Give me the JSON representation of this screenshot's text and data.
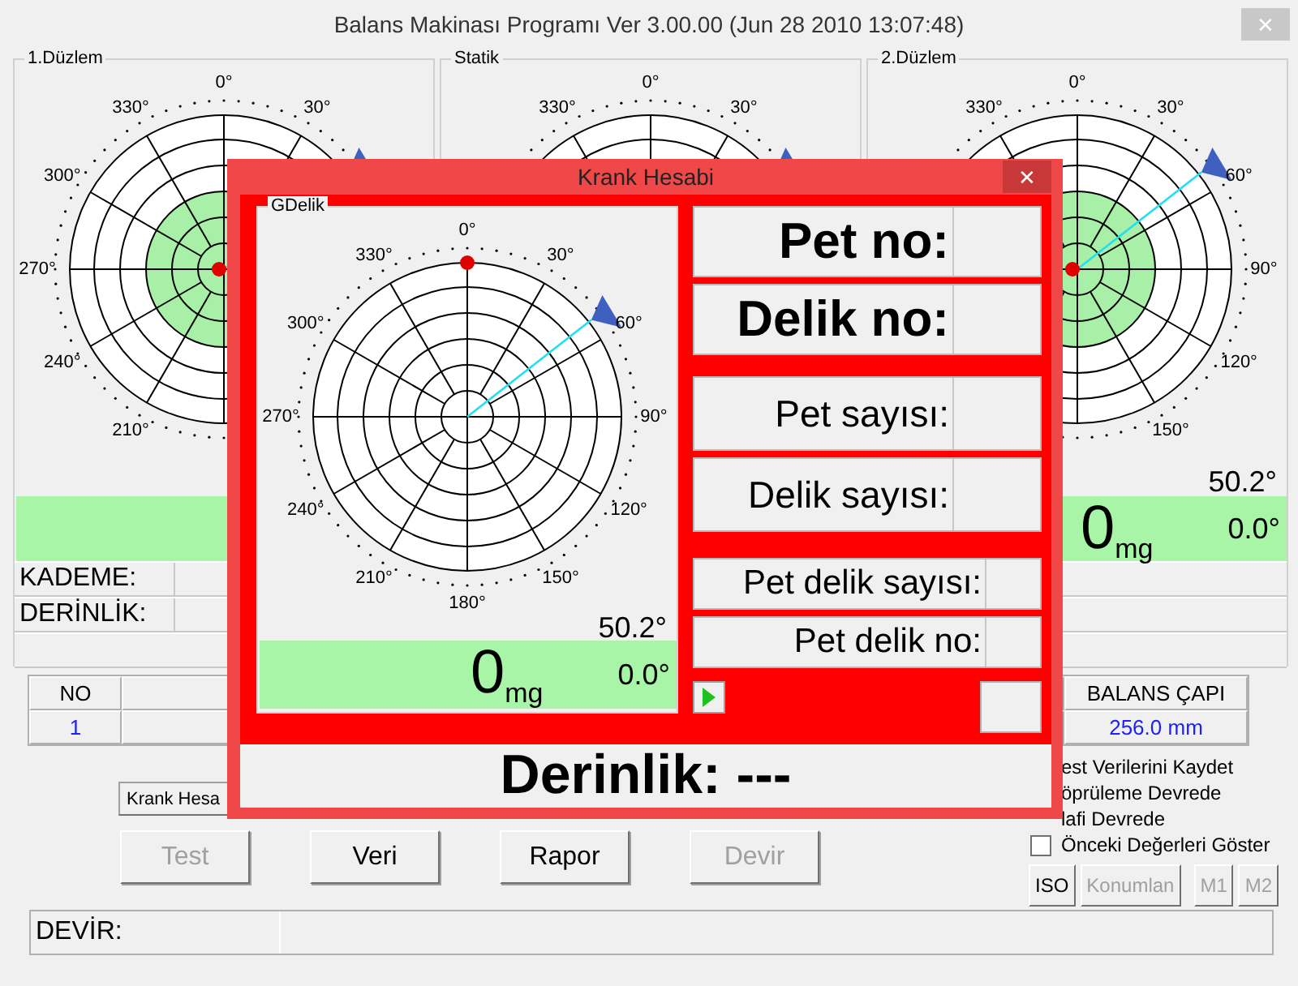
{
  "window": {
    "title": "Balans Makinası Programı Ver 3.00.00 (Jun 28 2010 13:07:48)",
    "close": "✕"
  },
  "planes": [
    {
      "title": "1.Düzlem",
      "polar": {
        "green_zone": true,
        "center_dot": true,
        "pointer": true,
        "labels": {
          "at_0": "0°",
          "at_30": "30°",
          "at_330": "330°",
          "at_300": "300°",
          "at_270": "270°",
          "at_240": "240°",
          "at_210": "210°"
        }
      },
      "reading_bar": true,
      "rows": [
        {
          "kind": "field",
          "label": "KADEME:"
        },
        {
          "kind": "field",
          "label": "DERİNLİK:"
        },
        {
          "kind": "blank"
        }
      ]
    },
    {
      "title": "Statik",
      "polar": {
        "pointer": true,
        "labels": {
          "at_0": "0°",
          "at_30": "30°",
          "at_330": "330°"
        }
      }
    },
    {
      "title": "2.Düzlem",
      "polar": {
        "green_zone": true,
        "center_dot": true,
        "pointer": true,
        "labels": {
          "at_0": "0°",
          "at_30": "30°",
          "at_60": "60°",
          "at_90": "90°",
          "at_120": "120°",
          "at_150": "150°",
          "at_330": "330°"
        }
      },
      "reading_bar": true,
      "angle": "50.2°",
      "amount": "0",
      "unit": "mg",
      "phase": "0.0°",
      "rows": [
        {
          "kind": "blank"
        },
        {
          "kind": "blank"
        },
        {
          "kind": "blank"
        }
      ]
    }
  ],
  "no_table": {
    "header": "NO",
    "value": "1"
  },
  "krank_button": {
    "label": "Krank Hesa"
  },
  "buttons": [
    {
      "label": "Test",
      "disabled": true
    },
    {
      "label": "Veri",
      "disabled": false
    },
    {
      "label": "Rapor",
      "disabled": false
    },
    {
      "label": "Devir",
      "disabled": true
    }
  ],
  "diameter_table": {
    "header": "BALANS ÇAPI",
    "value": "256.0 mm"
  },
  "options": [
    {
      "label": "est Verilerini Kaydet"
    },
    {
      "label": "öprüleme Devrede"
    },
    {
      "label": "lafi Devrede"
    },
    {
      "label": "Önceki Değerleri Göster",
      "checked": false
    }
  ],
  "tool_buttons": [
    {
      "label": "ISO",
      "disabled": false
    },
    {
      "label": "Konumlan",
      "disabled": true
    },
    {
      "label": "M1",
      "disabled": true
    },
    {
      "label": "M2",
      "disabled": true
    }
  ],
  "status": {
    "label": "DEVİR:"
  },
  "dialog": {
    "title": "Krank Hesabi",
    "close": "✕",
    "plane": {
      "title": "GDelik",
      "polar": {
        "rim_dot": true,
        "pointer": true,
        "labels": {
          "at_0": "0°",
          "at_30": "30°",
          "at_60": "60°",
          "at_90": "90°",
          "at_120": "120°",
          "at_150": "150°",
          "at_180": "180°",
          "at_210": "210°",
          "at_240": "240°",
          "at_270": "270°",
          "at_300": "300°",
          "at_330": "330°"
        }
      },
      "reading_bar": true,
      "angle": "50.2°",
      "amount": "0",
      "unit": "mg",
      "phase": "0.0°"
    },
    "fields": [
      {
        "kind": "large",
        "label": "Pet no:"
      },
      {
        "kind": "large",
        "label": "Delik no:"
      },
      {
        "kind": "medium",
        "label": "Pet sayısı:"
      },
      {
        "kind": "medium",
        "label": "Delik sayısı:"
      },
      {
        "kind": "small",
        "label": "Pet delik sayısı:"
      },
      {
        "kind": "small",
        "label": "Pet delik no:"
      }
    ],
    "depth": "Derinlik: ---"
  }
}
